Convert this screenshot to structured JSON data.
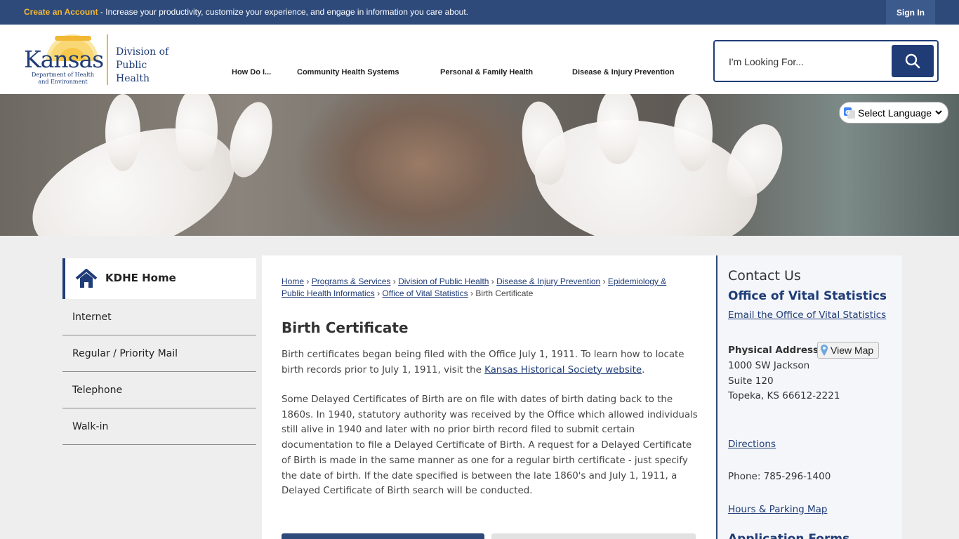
{
  "topbar": {
    "create_account": "Create an Account",
    "message": " - Increase your productivity, customize your experience, and engage in information you care about.",
    "sign_in": "Sign In"
  },
  "logo": {
    "kansas": "Kansas",
    "dept_line1": "Department of Health",
    "dept_line2": "and Environment",
    "division_line1": "Division of",
    "division_line2": "Public Health"
  },
  "nav": {
    "items": [
      {
        "label": "How Do I..."
      },
      {
        "label": "Community Health Systems"
      },
      {
        "label": "Personal & Family Health"
      },
      {
        "label": "Disease & Injury Prevention"
      }
    ]
  },
  "search": {
    "placeholder": "I'm Looking For...",
    "icon": "search-icon"
  },
  "language": {
    "selected": "Select Language"
  },
  "sidebar": {
    "home_label": "KDHE Home",
    "items": [
      {
        "label": "Internet"
      },
      {
        "label": "Regular / Priority Mail"
      },
      {
        "label": "Telephone"
      },
      {
        "label": "Walk-in"
      }
    ]
  },
  "breadcrumb": {
    "items": [
      {
        "label": "Home"
      },
      {
        "label": "Programs & Services"
      },
      {
        "label": "Division of Public Health"
      },
      {
        "label": "Disease & Injury Prevention"
      },
      {
        "label": "Epidemiology & Public Health Informatics"
      },
      {
        "label": "Office of Vital Statistics"
      }
    ],
    "current": "Birth Certificate"
  },
  "content": {
    "title": "Birth Certificate",
    "para1_text": "Birth certificates began being filed with the Office July 1, 1911. To learn how to locate birth records prior to July 1, 1911, visit the ",
    "para1_link": "Kansas Historical Society website",
    "para1_end": ".",
    "para2": "Some Delayed Certificates of Birth are on file with dates of birth dating back to the 1860s. In 1940, statutory authority was received by the Office which allowed individuals still alive in 1940 and later with no prior birth record filed to submit certain documentation to file a Delayed Certificate of Birth. A request for a Delayed Certificate of Birth is made in the same manner as one for a regular birth certificate - just specify the date of birth. If the date specified is between the late 1860's and July 1, 1911, a Delayed Certificate of Birth search will be conducted."
  },
  "contact": {
    "heading": "Contact Us",
    "office": "Office of Vital Statistics",
    "email_link": "Email the Office of Vital Statistics",
    "address_label": "Physical Address",
    "view_map": "View Map",
    "address_line1": "1000 SW Jackson",
    "address_line2": "Suite 120",
    "address_line3": "Topeka, KS 66612-2221",
    "directions": "Directions",
    "phone": "Phone: 785-296-1400",
    "hours": "Hours & Parking Map",
    "next_heading": "Application Forms"
  },
  "colors": {
    "brand_navy": "#1f3c77",
    "topbar": "#2e4a7b",
    "accent_gold": "#f2b733"
  }
}
